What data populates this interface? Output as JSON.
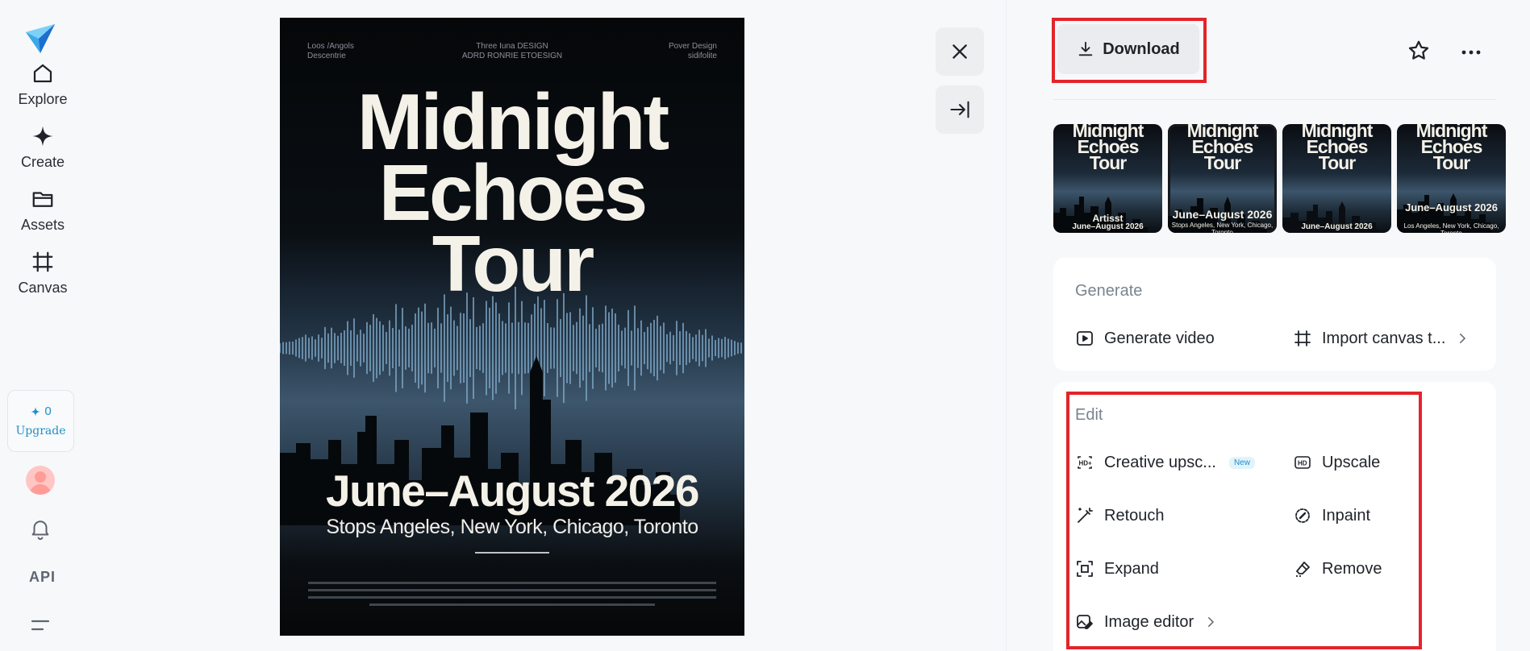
{
  "nav": {
    "items": [
      {
        "label": "Explore",
        "icon": "home-icon"
      },
      {
        "label": "Create",
        "icon": "sparkle-icon"
      },
      {
        "label": "Assets",
        "icon": "folder-icon"
      },
      {
        "label": "Canvas",
        "icon": "canvas-frame-icon"
      }
    ],
    "credits": "0",
    "upgrade_label": "Upgrade",
    "api_label": "API"
  },
  "poster": {
    "top_left": [
      "Loos /Angols",
      "Descentrie"
    ],
    "top_center": [
      "Three Iuna DESIGN",
      "ADRD RONRIE ETOESIGN"
    ],
    "top_right": [
      "Pover Design",
      "sidifolite"
    ],
    "title_lines": [
      "Midnight",
      "Echoes",
      "Tour"
    ],
    "dates": "June–August 2026",
    "stops": "Stops Angeles, New York, Chicago, Toronto"
  },
  "toolbar": {
    "download_label": "Download"
  },
  "thumbnails": [
    {
      "title": [
        "Midnight",
        "Echoes",
        "Tour"
      ],
      "sub": "Artisst",
      "sub2": "June–August 2026",
      "selected": false
    },
    {
      "title": [
        "Midnight",
        "Echoes",
        "Tour"
      ],
      "sub": "June–August 2026",
      "sub2": "Stops Angeles, New York, Chicago, Toronto",
      "selected": true
    },
    {
      "title": [
        "Midnight",
        "Echoes",
        "Tour"
      ],
      "sub": "",
      "sub2": "June–August 2026",
      "selected": false
    },
    {
      "title": [
        "Midnight",
        "Echoes",
        "Tour"
      ],
      "sub": "June–August 2026",
      "sub2": "Los Angeles, New York, Chicago, Toronto",
      "selected": false
    }
  ],
  "generate": {
    "title": "Generate",
    "actions": [
      {
        "label": "Generate video",
        "icon": "play-video-icon"
      },
      {
        "label": "Import canvas t...",
        "icon": "canvas-frame-icon"
      }
    ]
  },
  "edit": {
    "title": "Edit",
    "new_badge": "New",
    "actions": [
      {
        "label": "Creative upsc...",
        "icon": "hd-plus-icon"
      },
      {
        "label": "Upscale",
        "icon": "hd-icon"
      },
      {
        "label": "Retouch",
        "icon": "magic-wand-icon"
      },
      {
        "label": "Inpaint",
        "icon": "inpaint-brush-icon"
      },
      {
        "label": "Expand",
        "icon": "expand-icon"
      },
      {
        "label": "Remove",
        "icon": "eraser-icon"
      },
      {
        "label": "Image editor",
        "icon": "image-edit-icon"
      }
    ]
  },
  "colors": {
    "highlight": "#e3242b",
    "accent": "#1f8fc7",
    "background": "#f7f8fa"
  }
}
